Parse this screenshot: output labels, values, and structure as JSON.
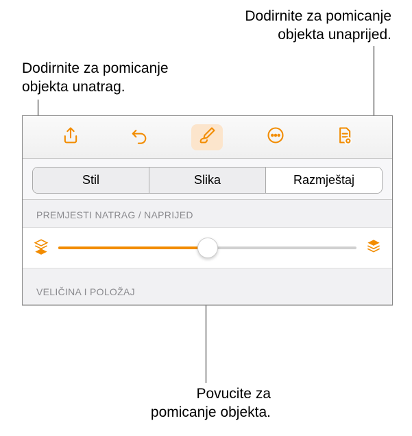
{
  "callouts": {
    "forward": "Dodirnite za pomicanje\nobjekta unaprijed.",
    "back": "Dodirnite za pomicanje\nobjekta unatrag.",
    "drag": "Povucite za\npomicanje objekta."
  },
  "tabs": {
    "style": "Stil",
    "image": "Slika",
    "arrange": "Razmještaj"
  },
  "sections": {
    "move_back_forward": "PREMJESTI NATRAG / NAPRIJED",
    "size_position": "VELIČINA I POLOŽAJ"
  }
}
